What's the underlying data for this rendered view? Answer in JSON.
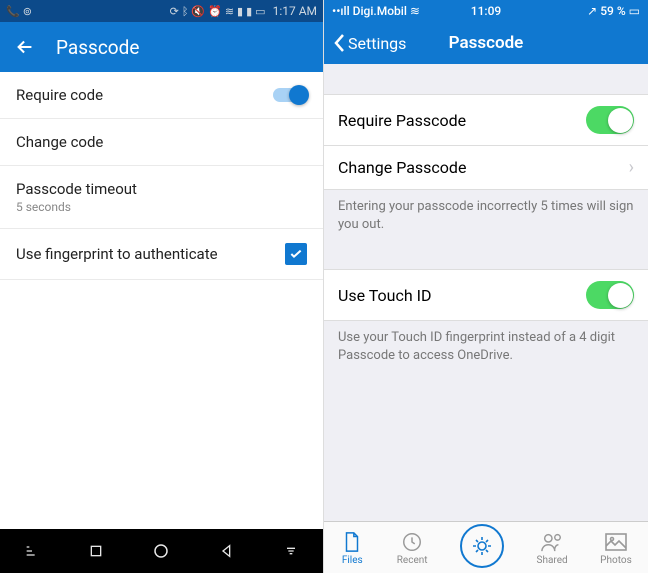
{
  "android": {
    "status": {
      "time": "1:17 AM"
    },
    "header": {
      "title": "Passcode"
    },
    "rows": {
      "require": "Require code",
      "change": "Change code",
      "timeout": "Passcode timeout",
      "timeout_sub": "5 seconds",
      "fingerprint": "Use fingerprint to authenticate"
    }
  },
  "ios": {
    "status": {
      "carrier": "Digi.Mobil",
      "time": "11:09",
      "battery": "59 %"
    },
    "header": {
      "back": "Settings",
      "title": "Passcode"
    },
    "rows": {
      "require": "Require Passcode",
      "change": "Change Passcode",
      "touchid": "Use Touch ID"
    },
    "footers": {
      "attempts": "Entering your passcode incorrectly 5 times will sign you out.",
      "touchid": "Use your Touch ID fingerprint instead of a 4 digit Passcode to access OneDrive."
    },
    "tabs": {
      "files": "Files",
      "recent": "Recent",
      "shared": "Shared",
      "photos": "Photos"
    }
  }
}
